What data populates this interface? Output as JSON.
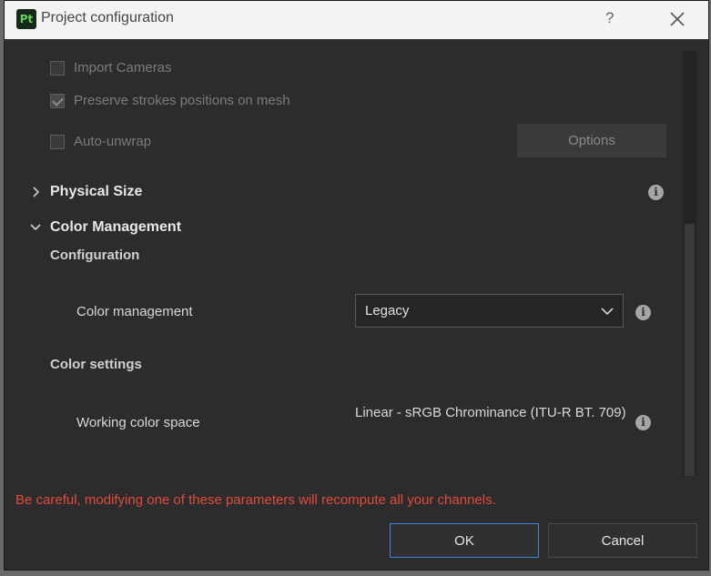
{
  "window": {
    "app_icon_text": "Pt",
    "title": "Project configuration",
    "help_label": "?"
  },
  "mesh_options": {
    "import_cameras": {
      "label": "Import Cameras",
      "checked": false
    },
    "preserve_strokes": {
      "label": "Preserve strokes positions on mesh",
      "checked": true
    },
    "auto_unwrap": {
      "label": "Auto-unwrap",
      "checked": false
    },
    "options_button": "Options"
  },
  "physical_size": {
    "title": "Physical Size",
    "expanded": false
  },
  "color_management": {
    "title": "Color Management",
    "expanded": true,
    "configuration_heading": "Configuration",
    "color_management_label": "Color management",
    "color_management_value": "Legacy",
    "color_settings_heading": "Color settings",
    "working_color_space_label": "Working color space",
    "working_color_space_value": "Linear - sRGB Chrominance (ITU-R BT. 709)"
  },
  "footer": {
    "warning": "Be careful, modifying one of these parameters will recompute all your channels.",
    "ok_label": "OK",
    "cancel_label": "Cancel"
  },
  "colors": {
    "warning": "#e24b3c",
    "ok_border": "#3d87d6",
    "background": "#2c2c2c"
  },
  "icons": {
    "info": "info-icon",
    "close": "close-icon",
    "chevron_right": "chevron-right-icon",
    "chevron_down": "chevron-down-icon"
  }
}
